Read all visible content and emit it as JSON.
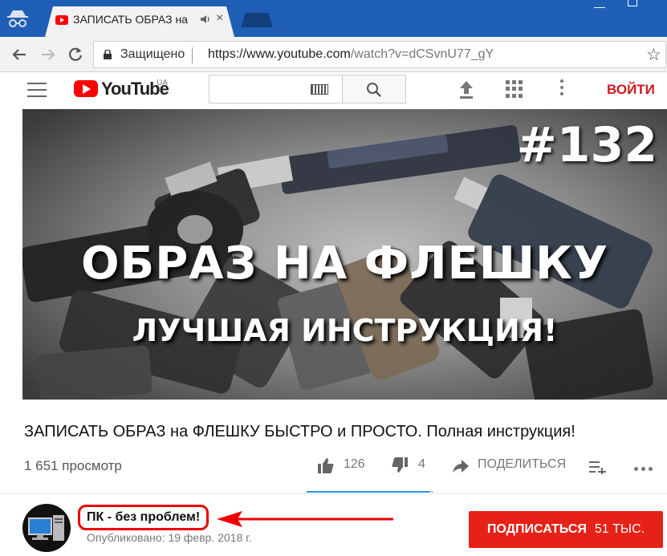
{
  "browser": {
    "tab_title": "ЗАПИСАТЬ ОБРАЗ на",
    "secure_label": "Защищено",
    "url_host": "https://www.youtube.com",
    "url_rest": "/watch?v=dCSvnU77_gY",
    "minimize_glyph": "—",
    "close_tab_glyph": "×",
    "star_glyph": "☆"
  },
  "youtube": {
    "logo_text": "YouTube",
    "region": "UA",
    "signin_label": "ВОЙТИ"
  },
  "thumbnail": {
    "episode": "#132",
    "headline": "ОБРАЗ НА ФЛЕШКУ",
    "subline": "ЛУЧШАЯ ИНСТРУКЦИЯ!"
  },
  "video": {
    "title": "ЗАПИСАТЬ ОБРАЗ на ФЛЕШКУ БЫСТРО и ПРОСТО. Полная инструкция!",
    "views": "1 651 просмотр",
    "likes": "126",
    "dislikes": "4",
    "share_label": "ПОДЕЛИТЬСЯ",
    "like_fraction": 0.97
  },
  "channel": {
    "name": "ПК - без проблем!",
    "published": "Опубликовано: 19 февр. 2018 г.",
    "subscribe_label": "ПОДПИСАТЬСЯ",
    "subscriber_count": "51 ТЫС."
  },
  "colors": {
    "chrome_blue": "#1f5fb6",
    "youtube_red": "#ff0000",
    "subscribe_red": "#e62117",
    "highlight_red": "#e00000",
    "sentiment_blue": "#2793e6"
  }
}
